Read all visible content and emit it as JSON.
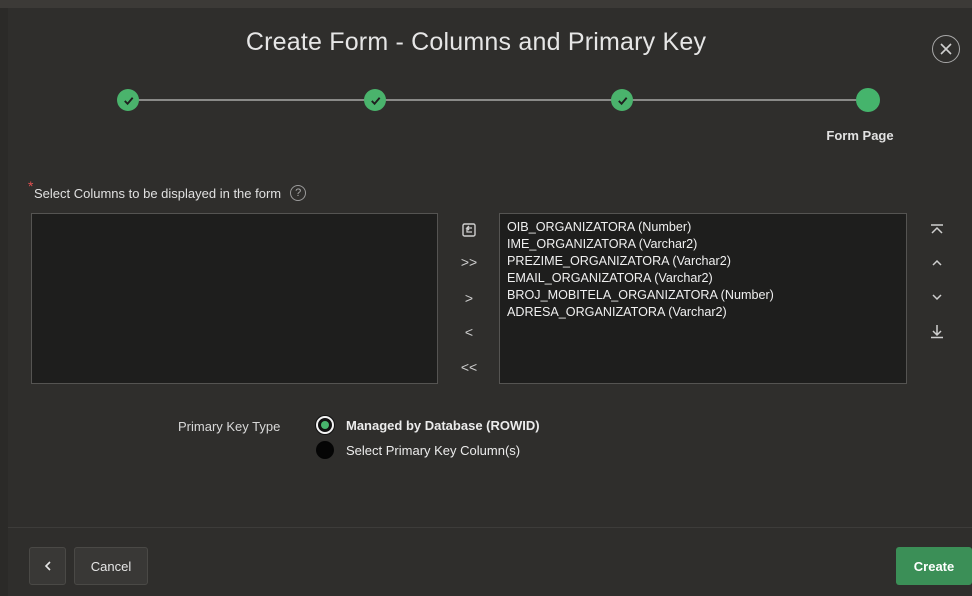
{
  "dialog": {
    "title": "Create Form - Columns and Primary Key"
  },
  "wizard": {
    "steps": [
      {
        "state": "complete"
      },
      {
        "state": "complete"
      },
      {
        "state": "complete"
      },
      {
        "state": "current",
        "label": "Form Page"
      }
    ]
  },
  "columns": {
    "label": "Select Columns to be displayed in the form",
    "required_marker": "*",
    "help_icon": "?",
    "available": [],
    "selected": [
      "OIB_ORGANIZATORA (Number)",
      "IME_ORGANIZATORA (Varchar2)",
      "PREZIME_ORGANIZATORA (Varchar2)",
      "EMAIL_ORGANIZATORA (Varchar2)",
      "BROJ_MOBITELA_ORGANIZATORA (Number)",
      "ADRESA_ORGANIZATORA (Varchar2)"
    ],
    "shuttle_controls": {
      "reset": "reset-icon",
      "move_all": ">>",
      "move": ">",
      "remove": "<",
      "remove_all": "<<"
    },
    "order_controls": [
      "move-top-icon",
      "move-up-icon",
      "move-down-icon",
      "move-bottom-icon"
    ]
  },
  "primary_key": {
    "label": "Primary Key Type",
    "options": [
      {
        "label": "Managed by Database (ROWID)",
        "checked": true
      },
      {
        "label": "Select Primary Key Column(s)",
        "checked": false
      }
    ]
  },
  "footer": {
    "cancel_label": "Cancel",
    "create_label": "Create"
  },
  "colors": {
    "accent_green": "#47b36c",
    "create_button": "#3b8f57",
    "background": "#2f2e2c"
  }
}
